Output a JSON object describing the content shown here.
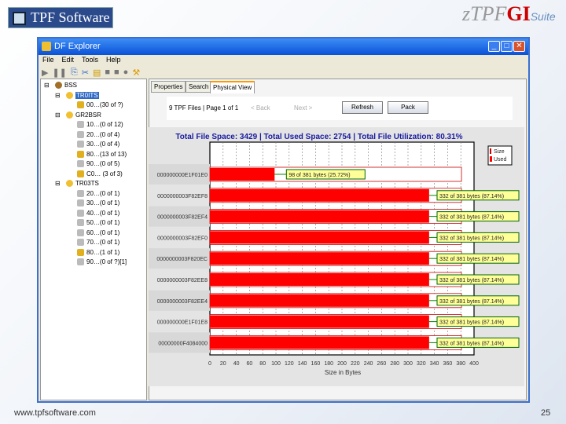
{
  "slide": {
    "logo": "TPF Software",
    "suite_logo_z": "z",
    "suite_logo_tpf": "TPF",
    "suite_logo_gi": "GI",
    "suite_logo_suite": "Suite",
    "footer_url": "www.tpfsoftware.com",
    "page_number": "25"
  },
  "window": {
    "title": "DF Explorer",
    "controls": [
      "_",
      "□",
      "✕"
    ],
    "menu": [
      "File",
      "Edit",
      "Tools",
      "Help"
    ]
  },
  "tree": [
    {
      "label": "BSS",
      "level": 0,
      "icon": "database-icon"
    },
    {
      "label": "TR0ITS",
      "level": 1,
      "icon": "file-icon",
      "selected": true
    },
    {
      "label": "00…(30 of ?)",
      "level": 2,
      "icon": "key-icon",
      "used": true
    },
    {
      "label": "GR2BSR",
      "level": 1,
      "icon": "file-icon"
    },
    {
      "label": "10…(0 of 12)",
      "level": 2,
      "icon": "key-icon"
    },
    {
      "label": "20…(0 of 4)",
      "level": 2,
      "icon": "key-icon"
    },
    {
      "label": "30…(0 of 4)",
      "level": 2,
      "icon": "key-icon"
    },
    {
      "label": "80…(13 of 13)",
      "level": 2,
      "icon": "key-icon",
      "used": true
    },
    {
      "label": "90…(0 of 5)",
      "level": 2,
      "icon": "key-icon"
    },
    {
      "label": "C0… (3 of 3)",
      "level": 2,
      "icon": "key-icon",
      "used": true
    },
    {
      "label": "TR03TS",
      "level": 1,
      "icon": "file-icon"
    },
    {
      "label": "20…(0 of 1)",
      "level": 2,
      "icon": "key-icon"
    },
    {
      "label": "30…(0 of 1)",
      "level": 2,
      "icon": "key-icon"
    },
    {
      "label": "40…(0 of 1)",
      "level": 2,
      "icon": "key-icon"
    },
    {
      "label": "50…(0 of 1)",
      "level": 2,
      "icon": "key-icon"
    },
    {
      "label": "60…(0 of 1)",
      "level": 2,
      "icon": "key-icon"
    },
    {
      "label": "70…(0 of 1)",
      "level": 2,
      "icon": "key-icon"
    },
    {
      "label": "80…(1 of 1)",
      "level": 2,
      "icon": "key-icon",
      "used": true
    },
    {
      "label": "90…(0 of ?)[1]",
      "level": 2,
      "icon": "key-icon"
    }
  ],
  "tabs": [
    "Properties",
    "Search",
    "Physical View"
  ],
  "nav": {
    "status": "9 TPF Files | Page 1 of 1",
    "back": "< Back",
    "next": "Next >",
    "refresh": "Refresh",
    "pack": "Pack"
  },
  "chart_data": {
    "type": "bar",
    "orientation": "horizontal",
    "title": "Total File Space: 3429 | Total Used Space: 2754 | Total File Utilization: 80.31%",
    "xlabel": "Size in Bytes",
    "xlim": [
      0,
      400
    ],
    "xticks": [
      0,
      20,
      40,
      60,
      80,
      100,
      120,
      140,
      160,
      180,
      200,
      220,
      240,
      260,
      280,
      300,
      320,
      340,
      360,
      380,
      400
    ],
    "legend": [
      "Size",
      "Used"
    ],
    "legend_position": "top-right",
    "categories": [
      "000000000E1F01E0",
      "0000000003F82EF8",
      "0000000003F82EF4",
      "0000000003F82EF0",
      "0000000003F820EC",
      "0000000003F82EE8",
      "0000000003F82EE4",
      "000000000E1F01E8",
      "00000000F4084000"
    ],
    "series": [
      {
        "name": "Used",
        "values": [
          98,
          332,
          332,
          332,
          332,
          332,
          332,
          332,
          332
        ]
      },
      {
        "name": "Size",
        "values": [
          381,
          381,
          381,
          381,
          381,
          381,
          381,
          381,
          381
        ]
      }
    ],
    "labels": [
      "98 of 381 bytes (25.72%)",
      "332 of 381 bytes (87.14%)",
      "332 of 381 bytes (87.14%)",
      "332 of 381 bytes (87.14%)",
      "332 of 381 bytes (87.14%)",
      "332 of 381 bytes (87.14%)",
      "332 of 381 bytes (87.14%)",
      "332 of 381 bytes (87.14%)",
      "332 of 381 bytes (87.14%)"
    ],
    "colors": {
      "used": "#ff0000",
      "size": "#cc0000",
      "label_bg": "#ffff99"
    }
  }
}
